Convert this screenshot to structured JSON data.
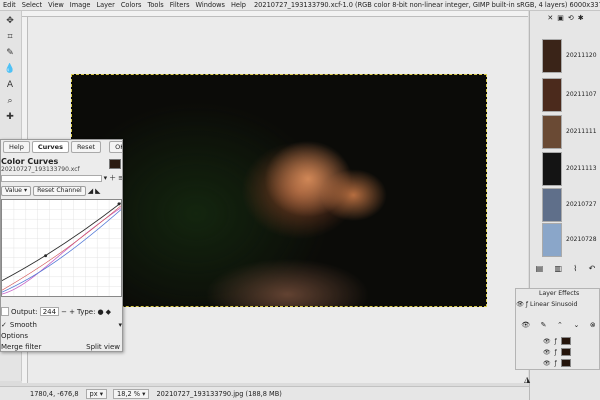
{
  "menubar": {
    "items": [
      "Edit",
      "Select",
      "View",
      "Image",
      "Layer",
      "Colors",
      "Tools",
      "Filters",
      "Windows",
      "Help"
    ],
    "window_title": "20210727_193133790.xcf-1.0 (RGB color 8-bit non-linear integer, GIMP built-in sRGB, 4 layers) 6000x3376 – GIMP"
  },
  "curves_dialog": {
    "tabs": [
      "Help",
      "Curves",
      "Reset",
      "OK"
    ],
    "title": "Color Curves",
    "subtitle": "20210727_193133790.xcf",
    "channel": "Value",
    "reset_channel": "Reset Channel",
    "output_label": "Output:",
    "output_value": "244",
    "type_label": "Type:",
    "curve_type": "Smooth",
    "options_label": "Options",
    "merge_filter": "Merge filter",
    "split_view": "Split view"
  },
  "images_panel": {
    "items": [
      {
        "name": "20211120",
        "color": "#3a2418"
      },
      {
        "name": "20211107",
        "color": "#4b2a1c"
      },
      {
        "name": "20211111",
        "color": "#6a4a34"
      },
      {
        "name": "20211113",
        "color": "#141414"
      },
      {
        "name": "20210727",
        "color": "#5f6f8a"
      },
      {
        "name": "20210728",
        "color": "#8aa6c9"
      }
    ]
  },
  "layers_panel": {
    "header": "Layer Effects",
    "filter_name": "Linear Sinusoid"
  },
  "statusbar": {
    "coords": "1780,4, -676,8",
    "unit": "px",
    "zoom": "18,2 %",
    "file_info": "20210727_193133790.jpg (188,8 MB)"
  },
  "colors": {
    "accent": "#3b6fc2",
    "curve": "#2a2a2a",
    "curve_red": "#d05050",
    "curve_blue": "#5077d6",
    "curve_magenta": "#c664c6"
  }
}
